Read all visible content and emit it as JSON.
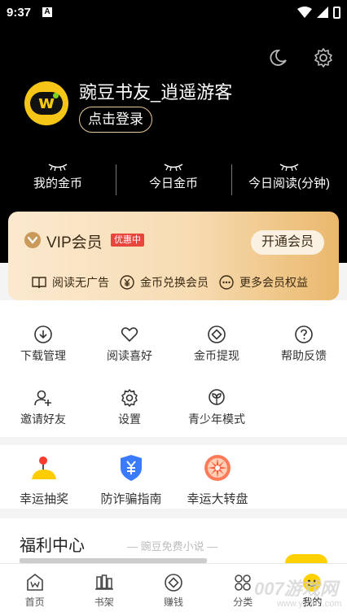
{
  "status_bar": {
    "time": "9:37",
    "sim_label": "A"
  },
  "profile": {
    "username": "豌豆书友_逍遥游客",
    "login_label": "点击登录"
  },
  "stats": [
    {
      "label": "我的金币"
    },
    {
      "label": "今日金币"
    },
    {
      "label": "今日阅读(分钟)"
    }
  ],
  "vip": {
    "title": "VIP会员",
    "badge": "优惠中",
    "open_label": "开通会员",
    "benefits": [
      "阅读无广告",
      "金币兑换会员",
      "更多会员权益"
    ]
  },
  "grid": [
    {
      "label": "下载管理",
      "icon": "download-icon"
    },
    {
      "label": "阅读喜好",
      "icon": "heart-icon"
    },
    {
      "label": "金币提现",
      "icon": "coin-icon"
    },
    {
      "label": "帮助反馈",
      "icon": "help-icon"
    },
    {
      "label": "邀请好友",
      "icon": "add-user-icon"
    },
    {
      "label": "设置",
      "icon": "gear-icon"
    },
    {
      "label": "青少年模式",
      "icon": "sprout-icon"
    }
  ],
  "activities": [
    {
      "label": "幸运抽奖",
      "icon": "lottery-icon"
    },
    {
      "label": "防诈骗指南",
      "icon": "shield-yen-icon"
    },
    {
      "label": "幸运大转盘",
      "icon": "wheel-icon"
    }
  ],
  "welfare": {
    "title": "福利中心",
    "subtitle": "— 豌豆免费小说 —"
  },
  "tabs": [
    {
      "label": "首页",
      "icon": "home-icon"
    },
    {
      "label": "书架",
      "icon": "bookshelf-icon"
    },
    {
      "label": "赚钱",
      "icon": "earn-icon"
    },
    {
      "label": "分类",
      "icon": "category-icon"
    },
    {
      "label": "我的",
      "icon": "mine-icon",
      "active": true
    }
  ],
  "watermark": {
    "text": "007游戏网",
    "url": "www.yx007.com"
  },
  "colors": {
    "header_bg": "#000000",
    "vip_gold": "#eab86c",
    "badge_red": "#e8453c",
    "avatar_yellow": "#f5c518",
    "sign_yellow": "#ffd100"
  }
}
